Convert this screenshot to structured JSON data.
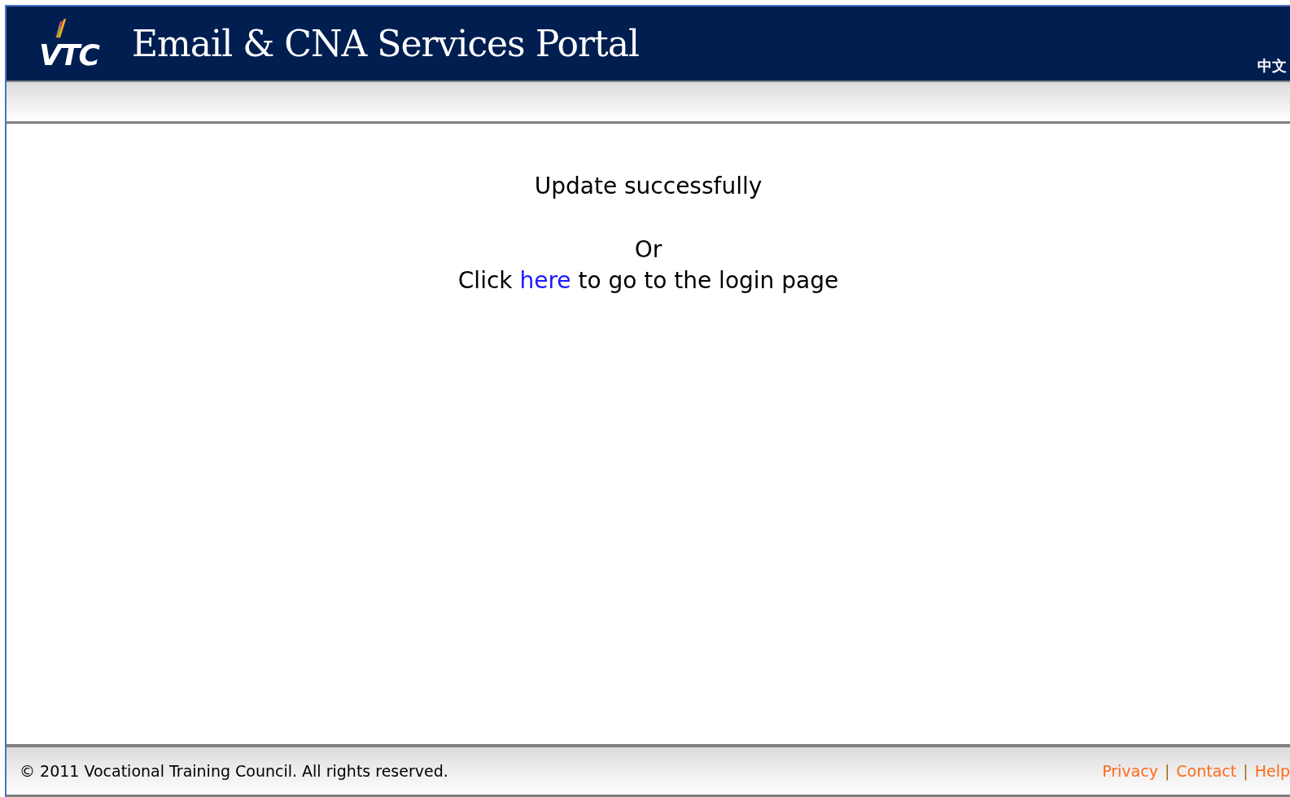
{
  "header": {
    "logo_text": "VTC",
    "title": "Email & CNA Services Portal",
    "language_link": "中文"
  },
  "message": {
    "status": "Update successfully",
    "or": "Or",
    "prompt_before": "Click ",
    "link": "here",
    "prompt_after": " to go to the login page"
  },
  "footer": {
    "copyright": "© 2011 Vocational Training Council. All rights reserved.",
    "links": [
      {
        "label": "Privacy"
      },
      {
        "label": "Contact"
      },
      {
        "label": "Help"
      }
    ],
    "separators": [
      "|",
      "|"
    ]
  }
}
